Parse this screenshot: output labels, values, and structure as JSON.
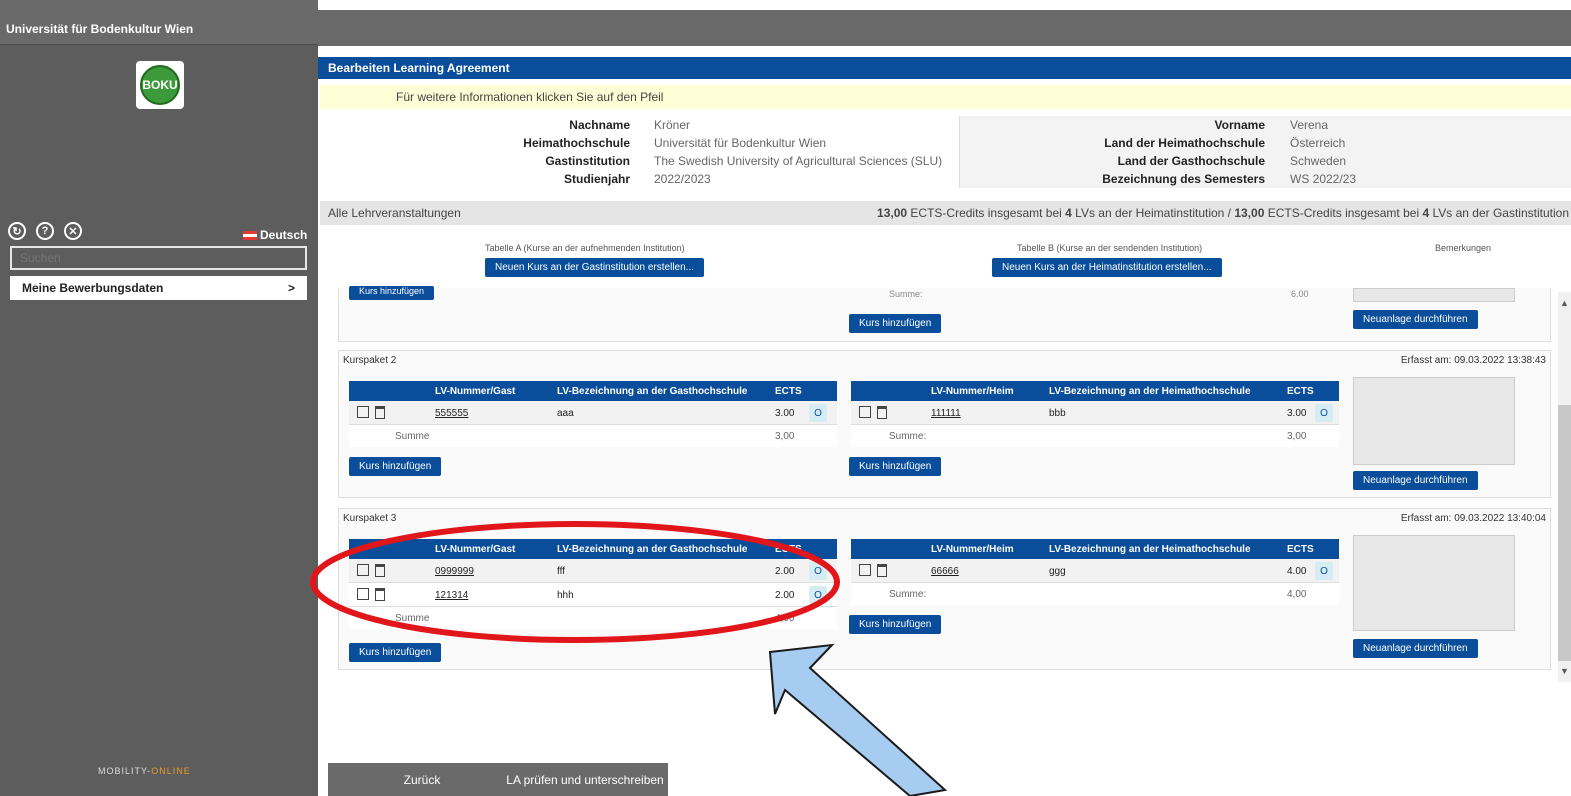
{
  "sidebar": {
    "university": "Universität für Bodenkultur Wien",
    "logo_text": "BOKU",
    "language": "Deutsch",
    "search_placeholder": "Suchen",
    "menu_item": "Meine Bewerbungsdaten",
    "menu_chevron": ">",
    "footer_logo_a": "MOBILITY-",
    "footer_logo_b": "ONLINE"
  },
  "header": {
    "title": "Bearbeiten Learning Agreement",
    "info": "Für weitere Informationen klicken Sie auf den Pfeil"
  },
  "personal": {
    "left_labels": [
      "Nachname",
      "Heimathochschule",
      "Gastinstitution",
      "Studienjahr"
    ],
    "left_values": [
      "Kröner",
      "Universität für Bodenkultur Wien",
      "The Swedish University of Agricultural Sciences (SLU)",
      "2022/2023"
    ],
    "right_labels": [
      "Vorname",
      "Land der Heimathochschule",
      "Land der Gasthochschule",
      "Bezeichnung des Semesters"
    ],
    "right_values": [
      "Verena",
      "Österreich",
      "Schweden",
      "WS 2022/23"
    ]
  },
  "courses_bar": {
    "left": "Alle Lehrveranstaltungen",
    "right_credits_a": "13,00",
    "right_text_a": " ECTS-Credits insgesamt bei ",
    "right_count_a": "4",
    "right_text_b": " LVs an der Heimatinstitution / ",
    "right_credits_b": "13,00",
    "right_text_c": " ECTS-Credits insgesamt bei ",
    "right_count_b": "4",
    "right_text_d": " LVs an der Gastinstitution"
  },
  "table_headers": {
    "a": "Tabelle A (Kurse an der aufnehmenden Institution)",
    "b": "Tabelle B (Kurse an der sendenden Institution)",
    "remarks": "Bemerkungen",
    "new_guest_button": "Neuen Kurs an der Gastinstitution erstellen...",
    "new_home_button": "Neuen Kurs an der Heimatinstitution erstellen..."
  },
  "common": {
    "add_course": "Kurs hinzufügen",
    "new_entry": "Neuanlage durchführen",
    "summe": "Summe",
    "summe_colon": "Summe:",
    "col_guest_num": "LV-Nummer/Gast",
    "col_guest_name": "LV-Bezeichnung an der Gasthochschule",
    "col_home_num": "LV-Nummer/Heim",
    "col_home_name": "LV-Bezeichnung an der Heimathochschule",
    "col_ects": "ECTS",
    "o_label": "O"
  },
  "package1_partial": {
    "home_sum": "6,00"
  },
  "package2": {
    "title": "Kurspaket 2",
    "date": "Erfasst am: 09.03.2022 13:38:43",
    "guest_rows": [
      {
        "num": "555555",
        "name": "aaa",
        "ects": "3.00"
      }
    ],
    "guest_sum": "3,00",
    "home_rows": [
      {
        "num": "111111",
        "name": "bbb",
        "ects": "3.00"
      }
    ],
    "home_sum": "3,00"
  },
  "package3": {
    "title": "Kurspaket 3",
    "date": "Erfasst am: 09.03.2022 13:40:04",
    "guest_rows": [
      {
        "num": "0999999",
        "name": "fff",
        "ects": "2.00"
      },
      {
        "num": "121314",
        "name": "hhh",
        "ects": "2.00"
      }
    ],
    "guest_sum": "4,00",
    "home_rows": [
      {
        "num": "66666",
        "name": "ggg",
        "ects": "4.00"
      }
    ],
    "home_sum": "4,00"
  },
  "footer": {
    "back": "Zurück",
    "check_sign": "LA prüfen und unterschreiben"
  },
  "colors": {
    "primary_blue": "#0a4e9b",
    "sidebar_grey": "#5d5d5d",
    "annotation_red": "#e0161a",
    "annotation_arrow": "#a6ccf2"
  }
}
